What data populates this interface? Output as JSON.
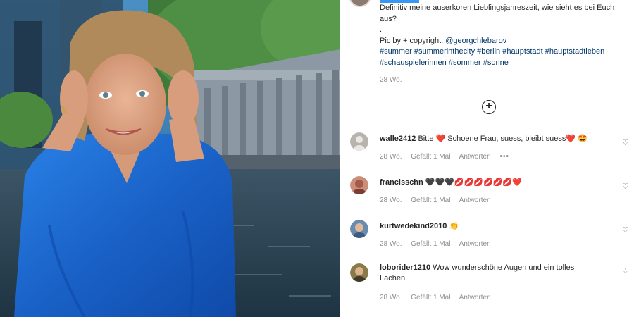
{
  "caption": {
    "line1": "Definitiv meine auserkoren Lieblingsjahreszeit, wie sieht es bei Euch aus?",
    "dot": ".",
    "pic_credit": "Pic by + copyright: ",
    "credit_handle": "@georgchlebarov",
    "hashtags_1": "#summer #summerinthecity #berlin #hauptstadt #hauptstadtleben",
    "hashtags_2": "#schauspielerinnen #sommer #sonne",
    "time": "28 Wo."
  },
  "load_more_icon": "plus-circle-icon",
  "comments": [
    {
      "user": "walle2412",
      "text": "Bitte ❤️ Schoene Frau, suess, bleibt suess❤️ 🤩",
      "time": "28 Wo.",
      "likes": "Gefällt 1 Mal",
      "reply": "Antworten",
      "more": "•••"
    },
    {
      "user": "francisschn",
      "text": "🖤🖤🖤💋💋💋💋💋💋❤️",
      "time": "28 Wo.",
      "likes": "Gefällt 1 Mal",
      "reply": "Antworten"
    },
    {
      "user": "kurtwedekind2010",
      "text": "👏",
      "time": "28 Wo.",
      "likes": "Gefällt 1 Mal",
      "reply": "Antworten"
    },
    {
      "user": "loborider1210",
      "text": "Wow wunderschöne Augen und ein tolles Lachen",
      "time": "28 Wo.",
      "likes": "Gefällt 1 Mal",
      "reply": "Antworten"
    }
  ],
  "colors": {
    "link": "#00376b",
    "muted": "#8e8e8e",
    "shirt": "#1f6fd6"
  }
}
